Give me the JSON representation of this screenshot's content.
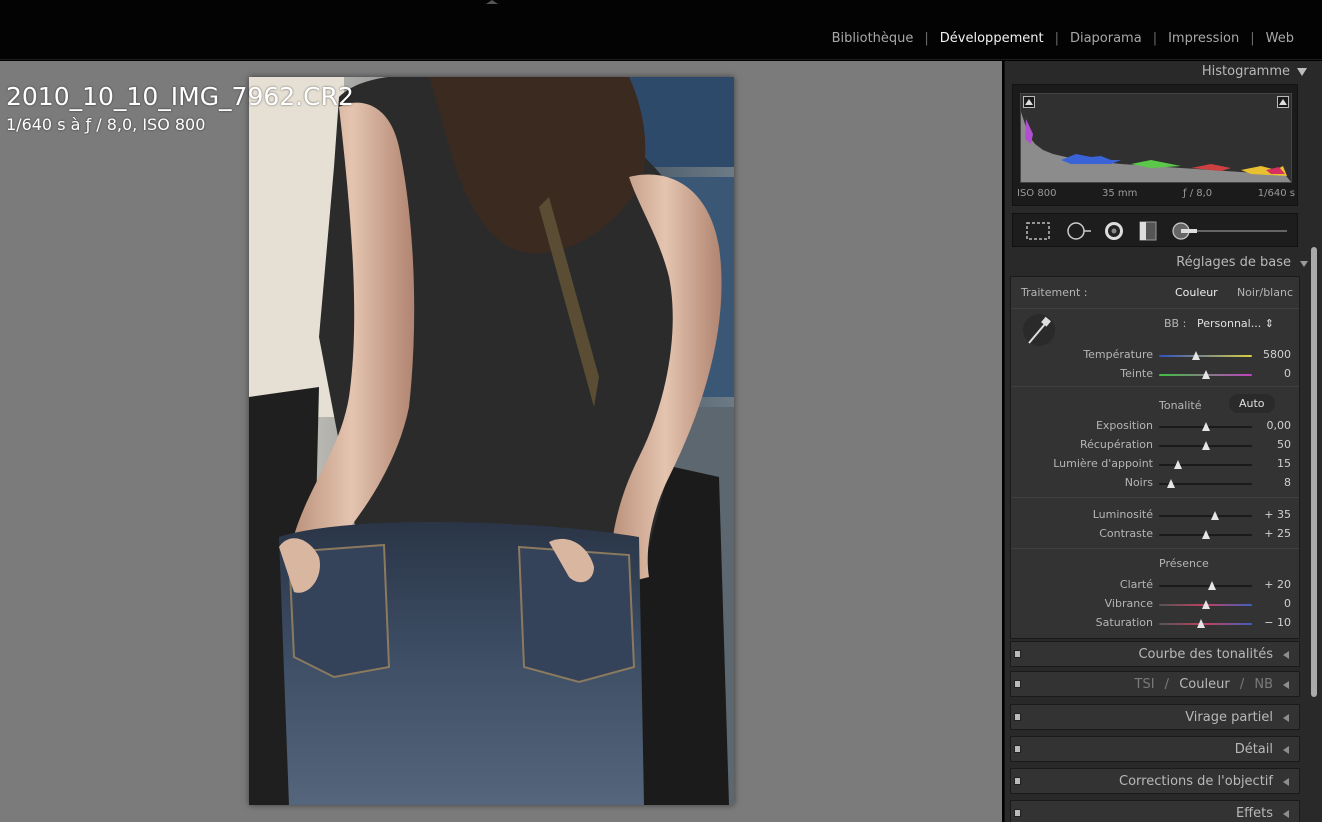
{
  "modules": {
    "items": [
      {
        "label": "Bibliothèque",
        "active": false
      },
      {
        "label": "Développement",
        "active": true
      },
      {
        "label": "Diaporama",
        "active": false
      },
      {
        "label": "Impression",
        "active": false
      },
      {
        "label": "Web",
        "active": false
      }
    ],
    "separator": "|"
  },
  "viewer": {
    "filename": "2010_10_10_IMG_7962.CR2",
    "exif": "1/640 s à ƒ / 8,0, ISO 800"
  },
  "histogram": {
    "title": "Histogramme",
    "iso": "ISO 800",
    "focal": "35 mm",
    "aperture": "ƒ / 8,0",
    "shutter": "1/640 s"
  },
  "tools": [
    "crop-icon",
    "spot-removal-icon",
    "red-eye-icon",
    "graduated-filter-icon",
    "adjustment-brush-icon"
  ],
  "basic": {
    "title": "Réglages de base",
    "treatment_label": "Traitement :",
    "treatment_color": "Couleur",
    "treatment_bw": "Noir/blanc",
    "wb_label": "BB :",
    "wb_value": "Personnal... ⇕",
    "tone_label": "Tonalité",
    "auto_label": "Auto",
    "presence_label": "Présence",
    "sliders": [
      {
        "label": "Température",
        "value": "5800",
        "pos": 0.4
      },
      {
        "label": "Teinte",
        "value": "0",
        "pos": 0.5
      },
      {
        "label": "Exposition",
        "value": "0,00",
        "pos": 0.5
      },
      {
        "label": "Récupération",
        "value": "50",
        "pos": 0.5
      },
      {
        "label": "Lumière d'appoint",
        "value": "15",
        "pos": 0.2
      },
      {
        "label": "Noirs",
        "value": "8",
        "pos": 0.13
      },
      {
        "label": "Luminosité",
        "value": "+ 35",
        "pos": 0.6
      },
      {
        "label": "Contraste",
        "value": "+ 25",
        "pos": 0.5
      },
      {
        "label": "Clarté",
        "value": "+ 20",
        "pos": 0.57
      },
      {
        "label": "Vibrance",
        "value": "0",
        "pos": 0.5
      },
      {
        "label": "Saturation",
        "value": "− 10",
        "pos": 0.45
      }
    ]
  },
  "panels": {
    "tone_curve": "Courbe des tonalités",
    "hsl_tsi": "TSI",
    "hsl_slash": "/",
    "hsl_color": "Couleur",
    "hsl_nb": "NB",
    "split_toning": "Virage partiel",
    "detail": "Détail",
    "lens": "Corrections de l'objectif",
    "effects": "Effets"
  },
  "colors": {
    "accent": "#f2f2f2",
    "panel_bg": "#292929",
    "section_bg": "#333333",
    "viewer_bg": "#7b7b7b"
  }
}
